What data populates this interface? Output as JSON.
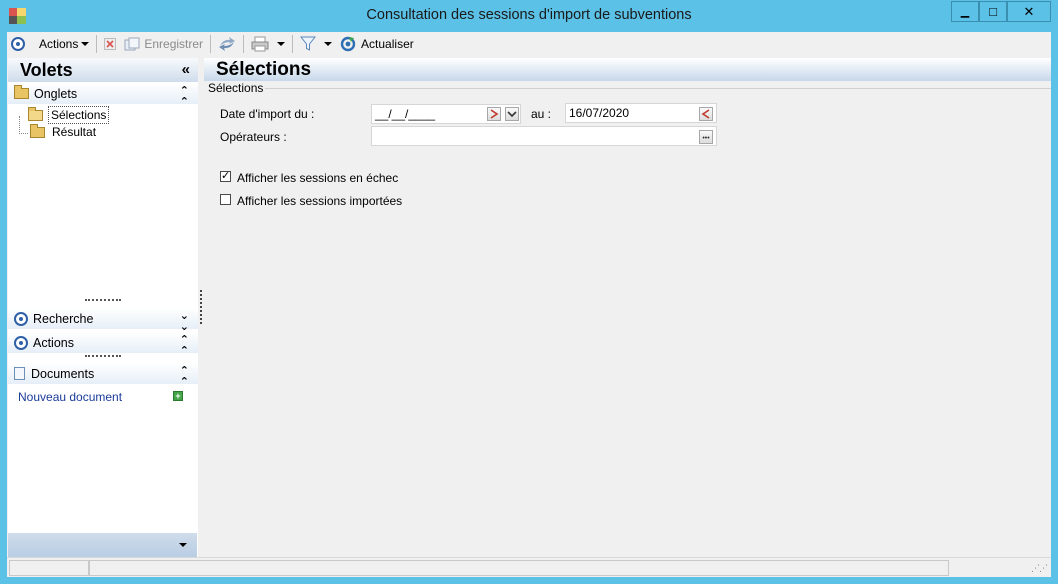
{
  "window": {
    "title": "Consultation des sessions d'import de subventions",
    "controls": {
      "minimize": "▁",
      "maximize": "□",
      "close": "✕"
    }
  },
  "toolbar": {
    "actions_label": "Actions",
    "save_label": "Enregistrer",
    "refresh_label": "Actualiser",
    "icons": [
      "circle-icon",
      "delete-icon",
      "save-icon",
      "sync-icon",
      "print-icon",
      "filter-icon",
      "refresh-icon"
    ]
  },
  "left_panel": {
    "title": "Volets",
    "collapse_all": "«",
    "groups": {
      "onglets": {
        "label": "Onglets",
        "chevron": "⌃",
        "items": [
          "Sélections",
          "Résultat"
        ]
      },
      "recherche": {
        "label": "Recherche",
        "chevron": "⌄"
      },
      "actions": {
        "label": "Actions",
        "chevron": "⌃"
      },
      "documents": {
        "label": "Documents",
        "chevron": "⌃",
        "link": "Nouveau document",
        "add": "+"
      }
    }
  },
  "main": {
    "title": "Sélections",
    "fieldset_legend": "Sélections",
    "date_from_label": "Date d'import du :",
    "date_from_value": "__/__/____",
    "date_to_label": "au :",
    "date_to_value": "16/07/2020",
    "operators_label": "Opérateurs :",
    "operators_value": "",
    "more_button": "•••",
    "checkbox_failed": {
      "label": "Afficher les sessions en échec",
      "checked": true,
      "mark": "✓"
    },
    "checkbox_imported": {
      "label": "Afficher les sessions importées",
      "checked": false
    }
  },
  "colors": {
    "frame": "#5bc1e6",
    "panel_header_gradient_end": "#cfdceb",
    "link": "#1b3b9a"
  }
}
